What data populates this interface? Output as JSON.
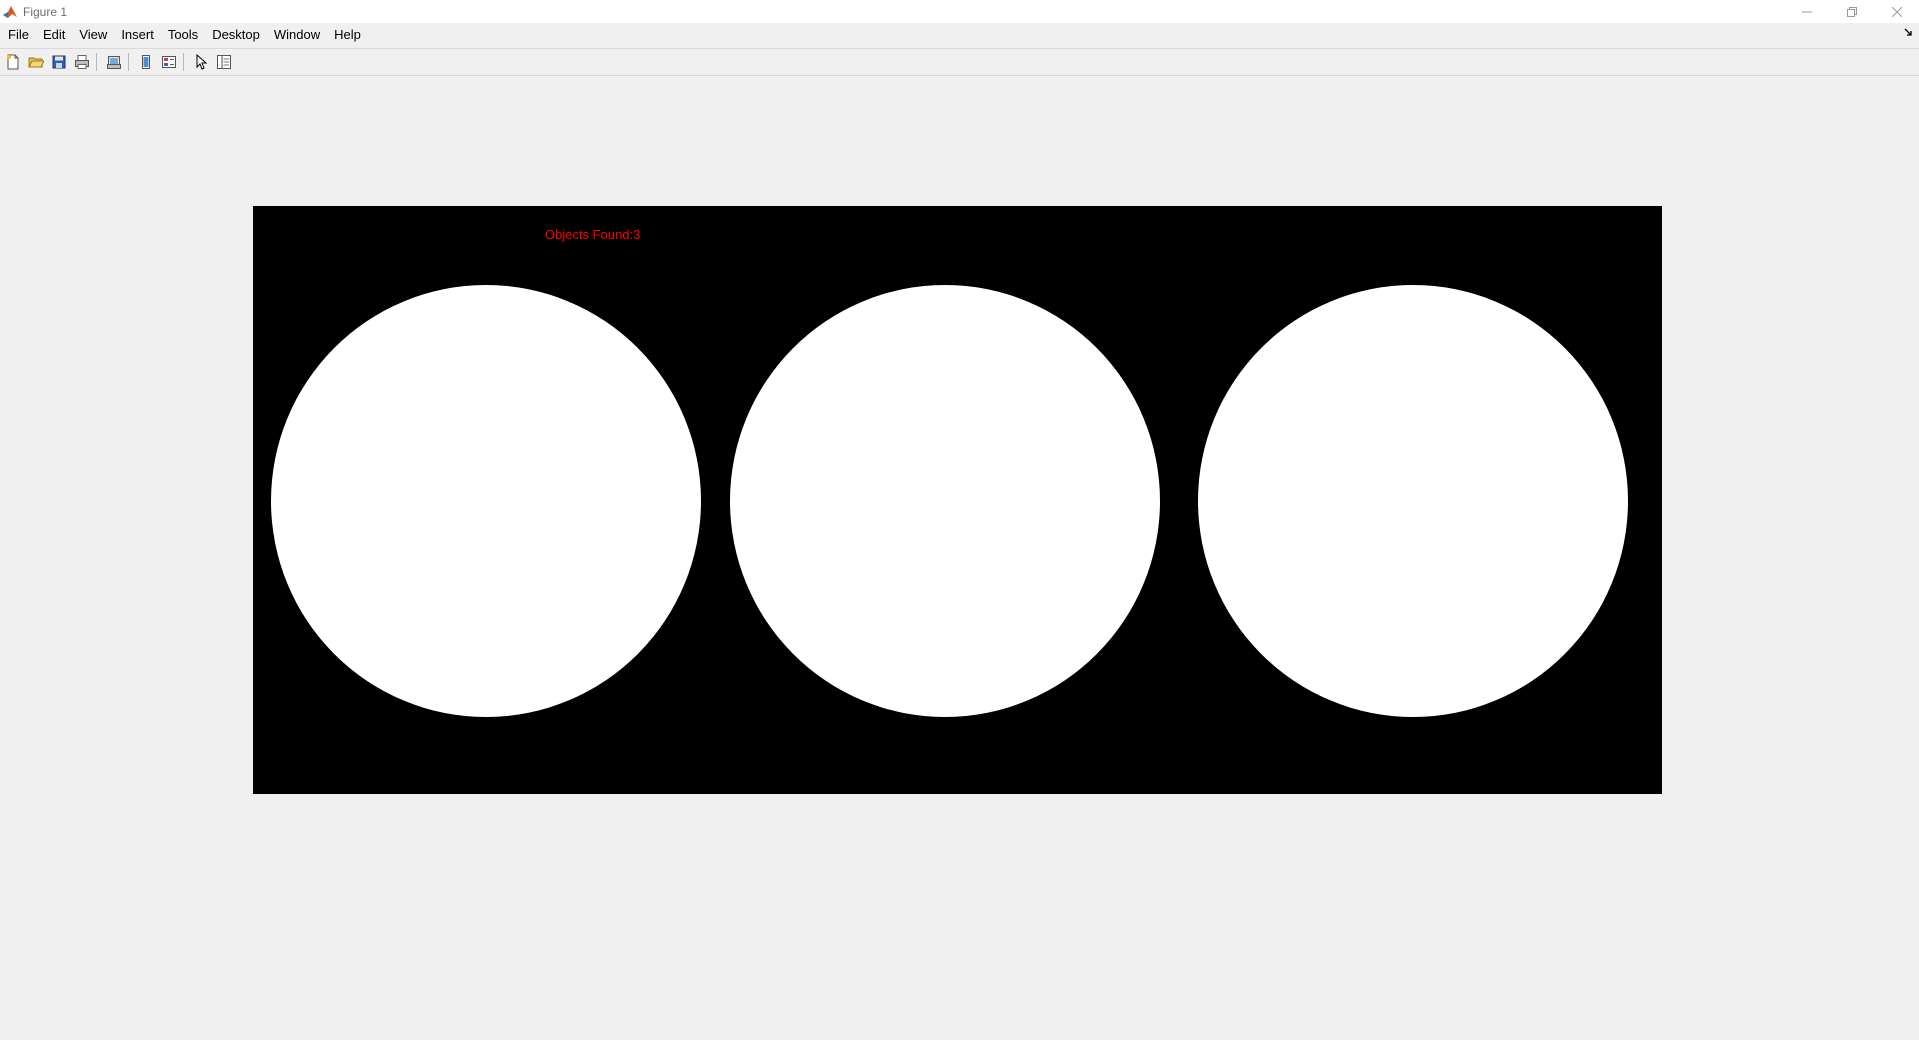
{
  "window": {
    "title": "Figure 1",
    "controls": [
      "minimize-icon",
      "restore-icon",
      "close-icon"
    ]
  },
  "menubar": {
    "items": [
      "File",
      "Edit",
      "View",
      "Insert",
      "Tools",
      "Desktop",
      "Window",
      "Help"
    ]
  },
  "toolbar": {
    "buttons": [
      "new-figure-icon",
      "open-file-icon",
      "save-icon",
      "print-icon",
      "print-preview-icon",
      "link-plot-icon",
      "insert-colorbar-icon",
      "edit-plot-icon",
      "property-inspector-icon"
    ]
  },
  "figure": {
    "annotation": "Objects Found:3",
    "annotation_color": "#ff0000",
    "background_color": "#000000",
    "object_color": "#ffffff",
    "objects_found": 3
  }
}
